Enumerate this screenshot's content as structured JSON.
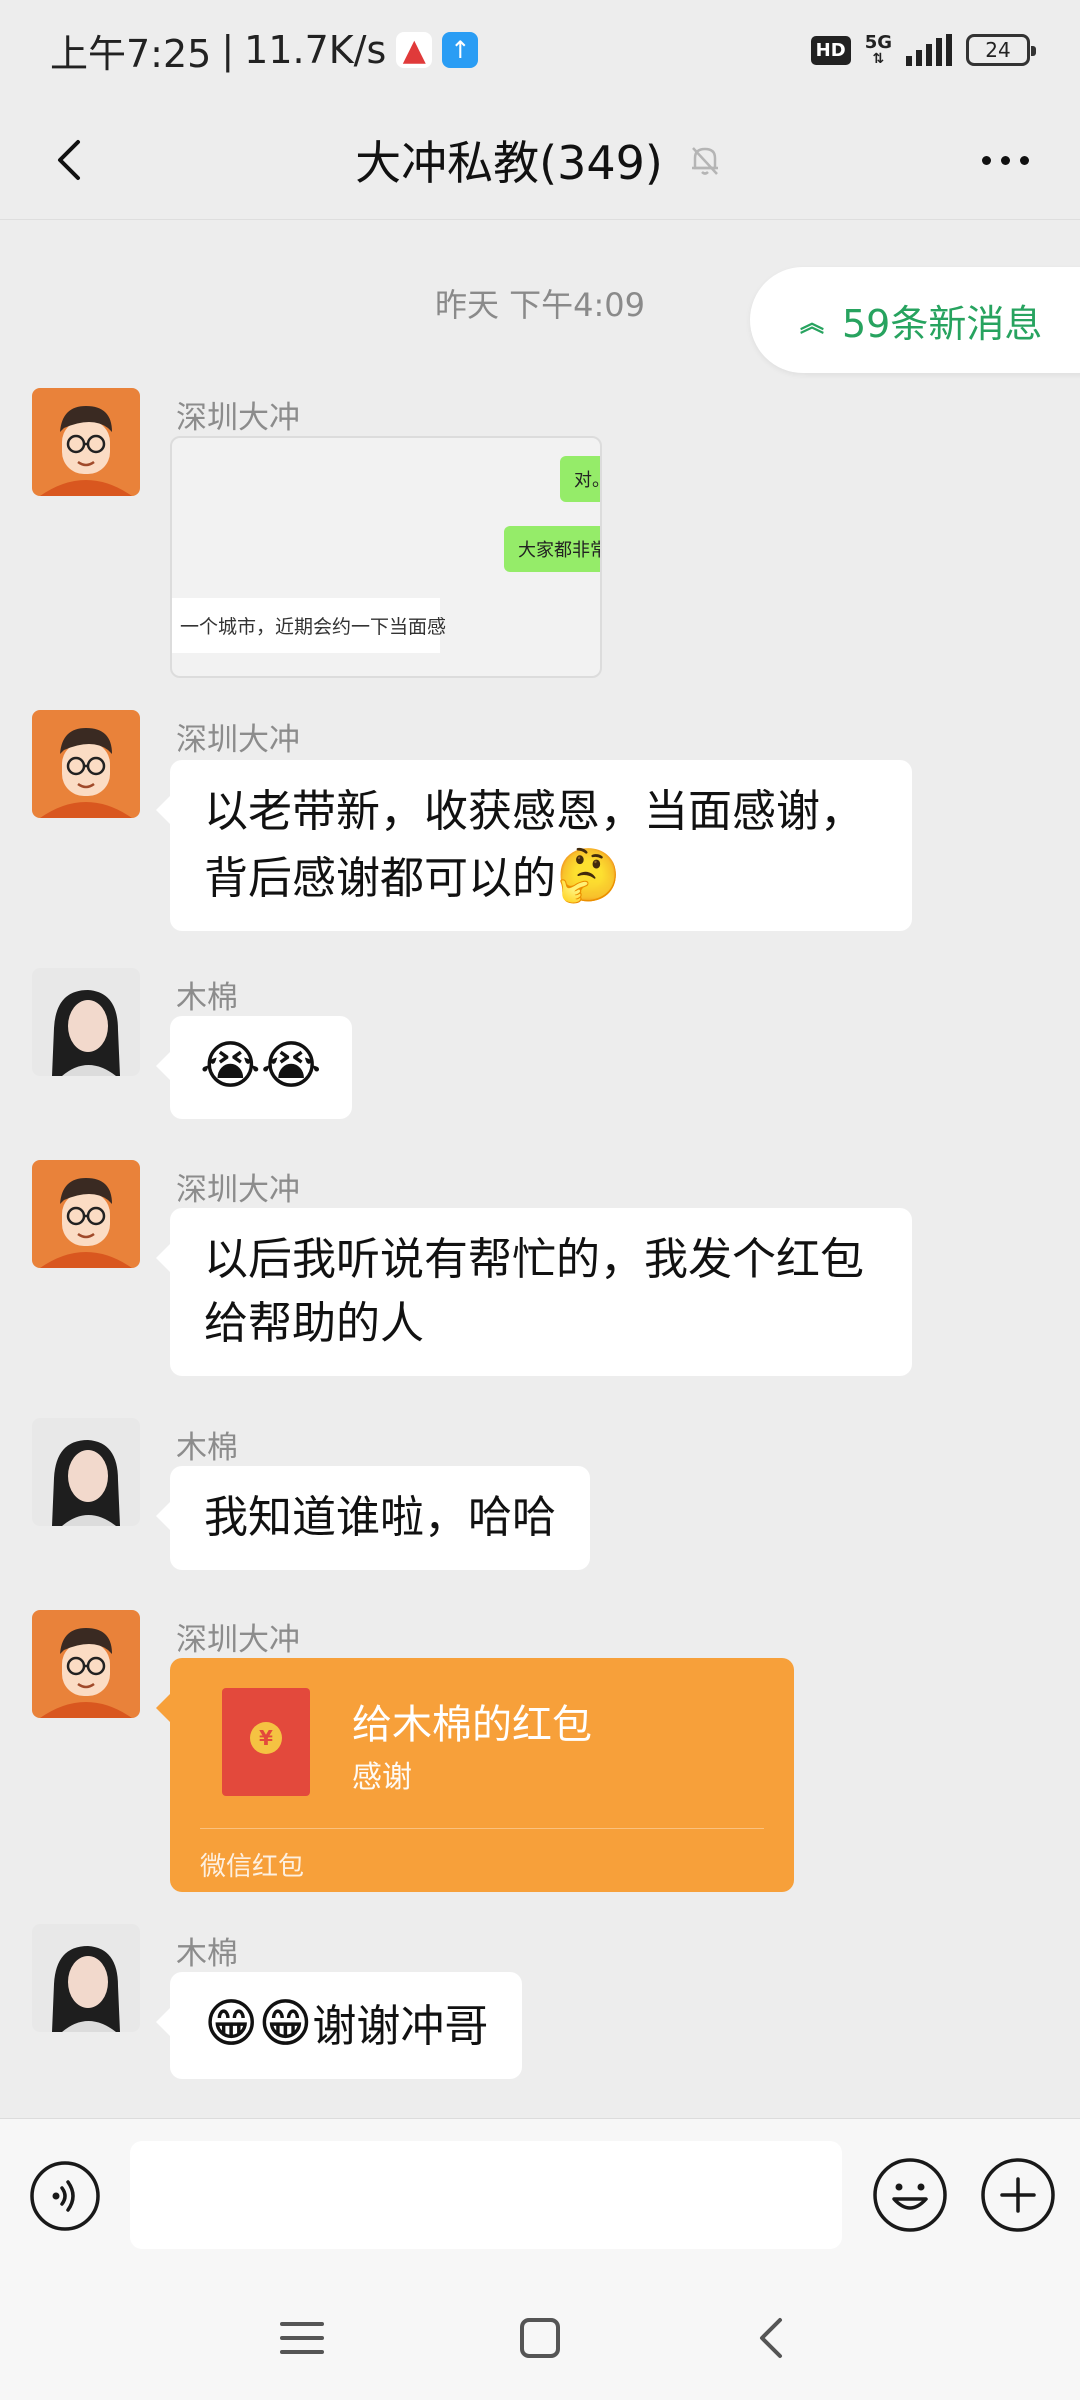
{
  "status_bar": {
    "time": "上午7:25",
    "separator": "|",
    "speed": "11.7K/s",
    "hd": "HD",
    "network": "5G",
    "battery": "24"
  },
  "header": {
    "title": "大冲私教(349)"
  },
  "chat": {
    "time_label": "昨天 下午4:09",
    "new_messages": "59条新消息",
    "image_message": {
      "sender": "深圳大冲",
      "lines": [
        "对。",
        "大家都非常",
        "一个城市，近期会约一下当面感"
      ]
    },
    "messages": [
      {
        "sender": "深圳大冲",
        "text": "以老带新，收获感恩，当面感谢，",
        "text2": "背后感谢都可以的",
        "emoji": "🤔"
      },
      {
        "sender": "木棉",
        "emoji": "😭😭"
      },
      {
        "sender": "深圳大冲",
        "text": "以后我听说有帮忙的，我发个红包",
        "text2": "给帮助的人"
      },
      {
        "sender": "木棉",
        "text": "我知道谁啦，哈哈"
      },
      {
        "sender": "深圳大冲"
      },
      {
        "sender": "木棉",
        "emoji": "😁😁",
        "text": "谢谢冲哥"
      }
    ],
    "red_packet": {
      "title": "给木棉的红包",
      "note": "感谢",
      "footer": "微信红包",
      "coin": "¥"
    }
  },
  "colors": {
    "background": "#ededed",
    "accent_green": "#27a35f",
    "red_packet": "#f7a03a"
  }
}
